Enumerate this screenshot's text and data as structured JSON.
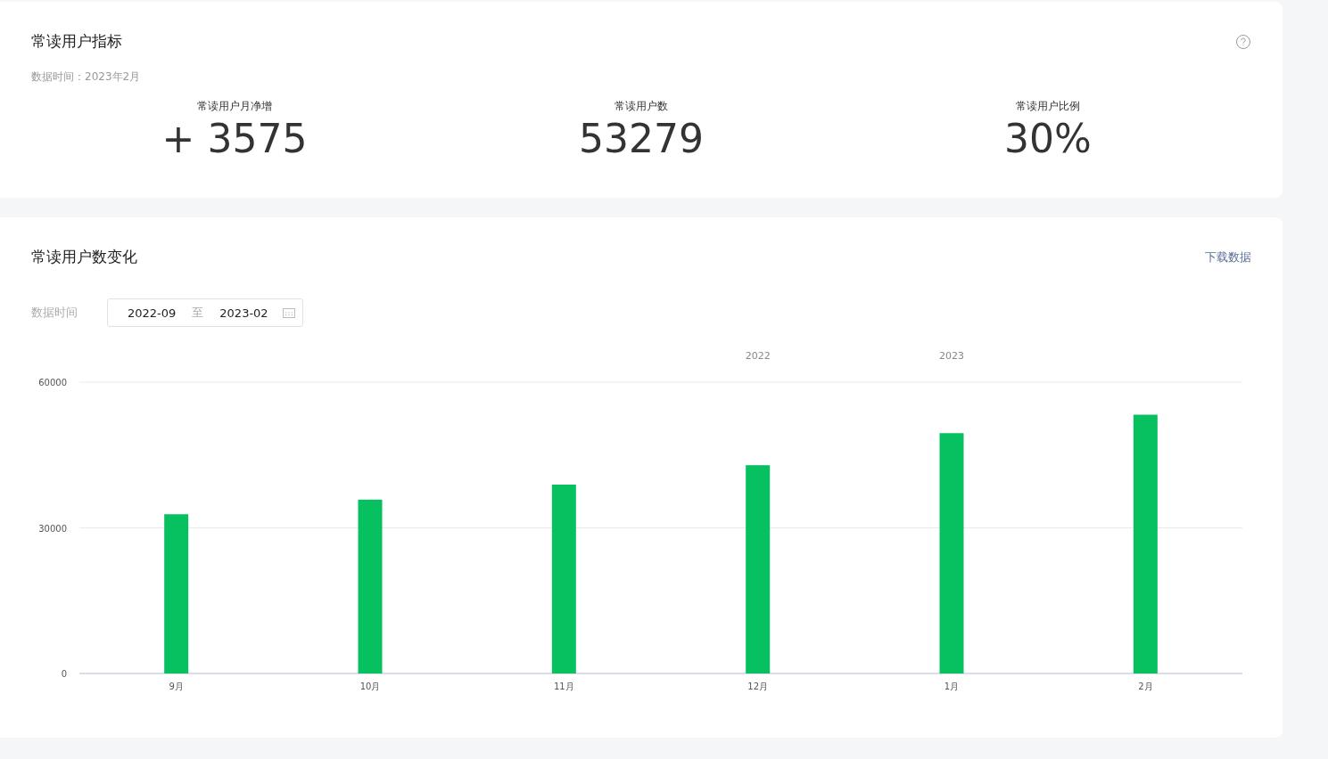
{
  "metrics_card": {
    "title": "常读用户指标",
    "data_time": "数据时间：2023年2月",
    "metrics": [
      {
        "label": "常读用户月净增",
        "value": "+ 3575"
      },
      {
        "label": "常读用户数",
        "value": "53279"
      },
      {
        "label": "常读用户比例",
        "value": "30%"
      }
    ]
  },
  "trend_card": {
    "title": "常读用户数变化",
    "download_link": "下载数据",
    "filter_label": "数据时间",
    "date_range": {
      "start": "2022-09",
      "separator": "至",
      "end": "2023-02"
    },
    "chart_data": {
      "type": "bar",
      "categories": [
        "9月",
        "10月",
        "11月",
        "12月",
        "1月",
        "2月"
      ],
      "series": [
        {
          "color": "#07c160",
          "values": [
            32800,
            35800,
            38900,
            42900,
            49500,
            53300
          ]
        }
      ],
      "ylim": [
        0,
        60000
      ],
      "yticks": [
        0,
        30000,
        60000
      ]
    },
    "year_labels": [
      "2022",
      "2023"
    ]
  }
}
